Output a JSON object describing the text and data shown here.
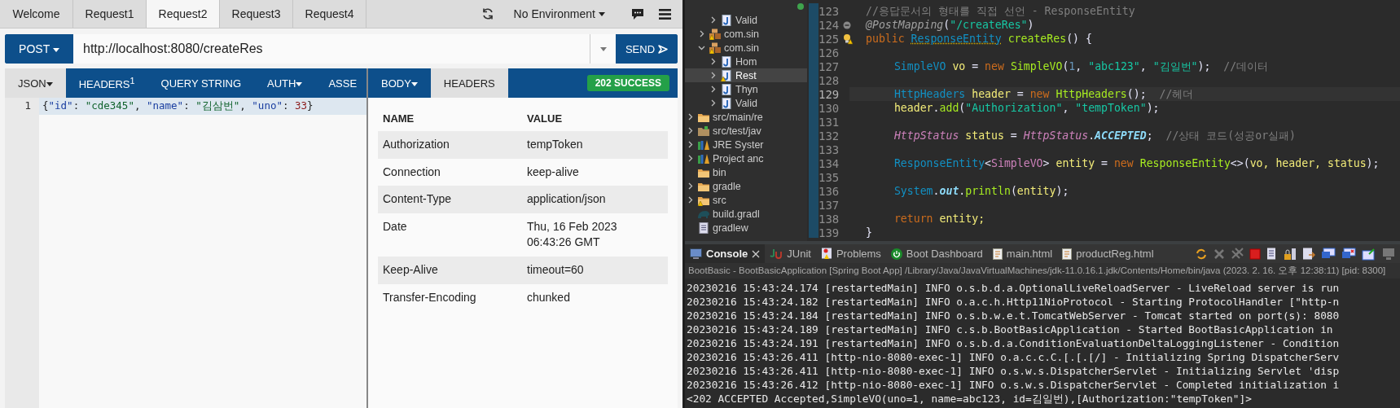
{
  "client": {
    "tabs": [
      {
        "label": "Welcome",
        "selected": false
      },
      {
        "label": "Request1",
        "selected": false
      },
      {
        "label": "Request2",
        "selected": true
      },
      {
        "label": "Request3",
        "selected": false
      },
      {
        "label": "Request4",
        "selected": false
      }
    ],
    "environment": "No Environment",
    "request": {
      "method": "POST",
      "url": "http://localhost:8080/createRes",
      "send": "SEND"
    },
    "request_tabs": [
      {
        "label": "JSON",
        "selected": true,
        "dropdown": true
      },
      {
        "label": "HEADERS$^{1}$",
        "selected": false,
        "dropdown": false
      },
      {
        "label": "QUERY STRING",
        "selected": false,
        "dropdown": false
      },
      {
        "label": "AUTH",
        "selected": false,
        "dropdown": true
      },
      {
        "label": "ASSE",
        "selected": false,
        "dropdown": false
      }
    ],
    "body_editor": {
      "line_number": "1",
      "tokens": [
        {
          "t": "{",
          "kind": "punct"
        },
        {
          "t": "\"id\"",
          "kind": "key"
        },
        {
          "t": ": ",
          "kind": "punct"
        },
        {
          "t": "\"cde345\"",
          "kind": "string"
        },
        {
          "t": ", ",
          "kind": "punct"
        },
        {
          "t": "\"name\"",
          "kind": "key"
        },
        {
          "t": ": ",
          "kind": "punct"
        },
        {
          "t": "\"김삼번\"",
          "kind": "string"
        },
        {
          "t": ", ",
          "kind": "punct"
        },
        {
          "t": "\"uno\"",
          "kind": "key"
        },
        {
          "t": ": ",
          "kind": "punct"
        },
        {
          "t": "33",
          "kind": "number"
        },
        {
          "t": "}",
          "kind": "punct"
        }
      ]
    },
    "response_tabs": [
      {
        "label": "BODY",
        "selected": false,
        "dropdown": true
      },
      {
        "label": "HEADERS",
        "selected": true,
        "dropdown": false
      }
    ],
    "status": "202 SUCCESS",
    "headers_table": {
      "columns": [
        "NAME",
        "VALUE"
      ],
      "rows": [
        [
          "Authorization",
          "tempToken"
        ],
        [
          "Connection",
          "keep-alive"
        ],
        [
          "Content-Type",
          "application/json"
        ],
        [
          "Date",
          "Thu, 16 Feb 2023 06:43:26 GMT"
        ],
        [
          "Keep-Alive",
          "timeout=60"
        ],
        [
          "Transfer-Encoding",
          "chunked"
        ]
      ]
    }
  },
  "ide": {
    "project_tree": {
      "cut_branch": {
        "children": [
          {
            "children": [
              {
                "label": "Valid",
                "kind": "java",
                "expanded": false,
                "selected": false,
                "warning": false
              }
            ]
          },
          {
            "label": "com.sin",
            "kind": "package",
            "expanded": false,
            "selected": false,
            "warning": true
          },
          {
            "label": "com.sin",
            "kind": "package",
            "expanded": true,
            "selected": false,
            "warning": true,
            "children": [
              {
                "label": "Hom",
                "kind": "java",
                "expanded": false,
                "selected": false,
                "warning": false
              },
              {
                "label": "Rest",
                "kind": "java",
                "expanded": false,
                "selected": true,
                "warning": true
              },
              {
                "label": "Thyn",
                "kind": "java",
                "expanded": false,
                "selected": false,
                "warning": false
              },
              {
                "label": "Valid",
                "kind": "java",
                "expanded": false,
                "selected": false,
                "warning": false
              }
            ]
          }
        ]
      },
      "items": [
        {
          "label": "src/main/re",
          "kind": "folder",
          "expanded": false,
          "selected": false,
          "warning": false
        },
        {
          "label": "src/test/jav",
          "kind": "sourcefolder",
          "expanded": false,
          "selected": false,
          "warning": false
        },
        {
          "label": "JRE Syster",
          "kind": "library",
          "expanded": false,
          "selected": false,
          "warning": false
        },
        {
          "label": "Project anc",
          "kind": "library",
          "expanded": false,
          "selected": false,
          "warning": false
        },
        {
          "label": "bin",
          "kind": "folder",
          "selected": false,
          "warning": false
        },
        {
          "label": "gradle",
          "kind": "folder",
          "expanded": false,
          "selected": false,
          "warning": false
        },
        {
          "label": "src",
          "kind": "folder",
          "expanded": false,
          "selected": false,
          "warning": true
        },
        {
          "label": "build.gradl",
          "kind": "gradle",
          "selected": false,
          "warning": false
        },
        {
          "label": "gradlew",
          "kind": "file",
          "selected": false,
          "warning": false
        }
      ]
    },
    "code_lines": [
      {
        "n": "123",
        "kind": "member",
        "current": false,
        "tokens": [
          {
            "t": "//응답문서의 형태를 직접 선언 - ResponseEntity",
            "kind": "comment"
          }
        ]
      },
      {
        "n": "124",
        "kind": "member",
        "current": false,
        "gutter_mark": {
          "kind": "fold"
        },
        "tokens": [
          {
            "t": "@PostMapping",
            "kind": "annotation"
          },
          {
            "t": "(",
            "kind": "plain"
          },
          {
            "t": "\"/createRes\"",
            "kind": "string"
          },
          {
            "t": ")",
            "kind": "plain"
          }
        ]
      },
      {
        "n": "125",
        "kind": "member",
        "current": false,
        "gutter_mark": {
          "kind": "warning"
        },
        "tokens": [
          {
            "t": "public ",
            "kind": "keyword"
          },
          {
            "t": "ResponseEntity",
            "kind": "warntype"
          },
          {
            "t": " createRes",
            "kind": "method"
          },
          {
            "t": "() {",
            "kind": "plain"
          }
        ]
      },
      {
        "n": "126",
        "current": false
      },
      {
        "n": "127",
        "kind": "body",
        "current": false,
        "tokens": [
          {
            "t": "SimpleVO",
            "kind": "type"
          },
          {
            "t": " vo",
            "kind": "var"
          },
          {
            "t": " = ",
            "kind": "plain"
          },
          {
            "t": "new",
            "kind": "keyword"
          },
          {
            "t": " SimpleVO",
            "kind": "method"
          },
          {
            "t": "(",
            "kind": "plain"
          },
          {
            "t": "1",
            "kind": "number"
          },
          {
            "t": ", ",
            "kind": "plain"
          },
          {
            "t": "\"abc123\"",
            "kind": "string"
          },
          {
            "t": ", ",
            "kind": "plain"
          },
          {
            "t": "\"김일번\"",
            "kind": "string"
          },
          {
            "t": ");  ",
            "kind": "plain"
          },
          {
            "t": "//데이터",
            "kind": "comment"
          }
        ]
      },
      {
        "n": "128",
        "current": false
      },
      {
        "n": "129",
        "kind": "body",
        "current": true,
        "tokens": [
          {
            "t": "HttpHeaders",
            "kind": "type"
          },
          {
            "t": " header",
            "kind": "var"
          },
          {
            "t": " = ",
            "kind": "plain"
          },
          {
            "t": "new",
            "kind": "keyword"
          },
          {
            "t": " HttpHeaders",
            "kind": "method"
          },
          {
            "t": "();  ",
            "kind": "plain"
          },
          {
            "t": "//헤더",
            "kind": "comment"
          }
        ]
      },
      {
        "n": "130",
        "kind": "body",
        "current": false,
        "tokens": [
          {
            "t": "header",
            "kind": "var"
          },
          {
            "t": ".",
            "kind": "plain"
          },
          {
            "t": "add",
            "kind": "method"
          },
          {
            "t": "(",
            "kind": "plain"
          },
          {
            "t": "\"Authorization\"",
            "kind": "string"
          },
          {
            "t": ", ",
            "kind": "plain"
          },
          {
            "t": "\"tempToken\"",
            "kind": "string"
          },
          {
            "t": ");",
            "kind": "plain"
          }
        ]
      },
      {
        "n": "131",
        "current": false
      },
      {
        "n": "132",
        "kind": "body",
        "current": false,
        "tokens": [
          {
            "t": "HttpStatus",
            "kind": "enum"
          },
          {
            "t": " status",
            "kind": "var"
          },
          {
            "t": " = ",
            "kind": "plain"
          },
          {
            "t": "HttpStatus",
            "kind": "enum"
          },
          {
            "t": ".",
            "kind": "plain"
          },
          {
            "t": "ACCEPTED",
            "kind": "constant"
          },
          {
            "t": ";  ",
            "kind": "plain"
          },
          {
            "t": "//상태 코드(성공or실패)",
            "kind": "comment"
          }
        ]
      },
      {
        "n": "133",
        "current": false
      },
      {
        "n": "134",
        "kind": "body",
        "current": false,
        "tokens": [
          {
            "t": "ResponseEntity",
            "kind": "type"
          },
          {
            "t": "<",
            "kind": "plain"
          },
          {
            "t": "SimpleVO",
            "kind": "typeparam"
          },
          {
            "t": ">",
            "kind": "plain"
          },
          {
            "t": " entity",
            "kind": "var"
          },
          {
            "t": " = ",
            "kind": "plain"
          },
          {
            "t": "new",
            "kind": "keyword"
          },
          {
            "t": " ResponseEntity",
            "kind": "method"
          },
          {
            "t": "<>(",
            "kind": "plain"
          },
          {
            "t": "vo, header, status",
            "kind": "var"
          },
          {
            "t": ");",
            "kind": "plain"
          }
        ]
      },
      {
        "n": "135",
        "current": false
      },
      {
        "n": "136",
        "kind": "body",
        "current": false,
        "tokens": [
          {
            "t": "System",
            "kind": "type"
          },
          {
            "t": ".",
            "kind": "plain"
          },
          {
            "t": "out",
            "kind": "field"
          },
          {
            "t": ".",
            "kind": "plain"
          },
          {
            "t": "println",
            "kind": "method"
          },
          {
            "t": "(",
            "kind": "plain"
          },
          {
            "t": "entity",
            "kind": "var"
          },
          {
            "t": ");",
            "kind": "plain"
          }
        ]
      },
      {
        "n": "137",
        "current": false
      },
      {
        "n": "138",
        "kind": "body",
        "current": false,
        "tokens": [
          {
            "t": "return",
            "kind": "keyword"
          },
          {
            "t": " entity;",
            "kind": "var"
          }
        ]
      },
      {
        "n": "139",
        "kind": "member",
        "current": false,
        "tokens": [
          {
            "t": "}",
            "kind": "plain"
          }
        ]
      }
    ],
    "console_tabs": [
      {
        "label": "Console",
        "kind": "console",
        "selected": true,
        "closable": true
      },
      {
        "label": "JUnit",
        "kind": "junit",
        "selected": false,
        "closable": false
      },
      {
        "label": "Problems",
        "kind": "problems",
        "selected": false,
        "closable": false
      },
      {
        "label": "Boot Dashboard",
        "kind": "power",
        "selected": false,
        "closable": false
      },
      {
        "label": "main.html",
        "kind": "file",
        "selected": false,
        "closable": false
      },
      {
        "label": "productReg.html",
        "kind": "file",
        "selected": false,
        "closable": false
      }
    ],
    "console_header": "BootBasic - BootBasicApplication [Spring Boot App] /Library/Java/JavaVirtualMachines/jdk-11.0.16.1.jdk/Contents/Home/bin/java  (2023. 2. 16. 오후 12:38:11) [pid: 8300]",
    "console_lines": [
      "20230216 15:43:24.174 [restartedMain] INFO o.s.b.d.a.OptionalLiveReloadServer - LiveReload server is run",
      "20230216 15:43:24.182 [restartedMain] INFO o.a.c.h.Http11NioProtocol - Starting ProtocolHandler [\"http-n",
      "20230216 15:43:24.184 [restartedMain] INFO o.s.b.w.e.t.TomcatWebServer - Tomcat started on port(s): 8080",
      "20230216 15:43:24.189 [restartedMain] INFO c.s.b.BootBasicApplication - Started BootBasicApplication in",
      "20230216 15:43:24.191 [restartedMain] INFO o.s.b.d.a.ConditionEvaluationDeltaLoggingListener - Condition",
      "20230216 15:43:26.411 [http-nio-8080-exec-1] INFO o.a.c.c.C.[.[.[/] - Initializing Spring DispatcherServ",
      "20230216 15:43:26.411 [http-nio-8080-exec-1] INFO o.s.w.s.DispatcherServlet - Initializing Servlet 'disp",
      "20230216 15:43:26.412 [http-nio-8080-exec-1] INFO o.s.w.s.DispatcherServlet - Completed initialization i",
      "<202 ACCEPTED Accepted,SimpleVO(uno=1, name=abc123, id=김일번),[Authorization:\"tempToken\"]>"
    ]
  }
}
